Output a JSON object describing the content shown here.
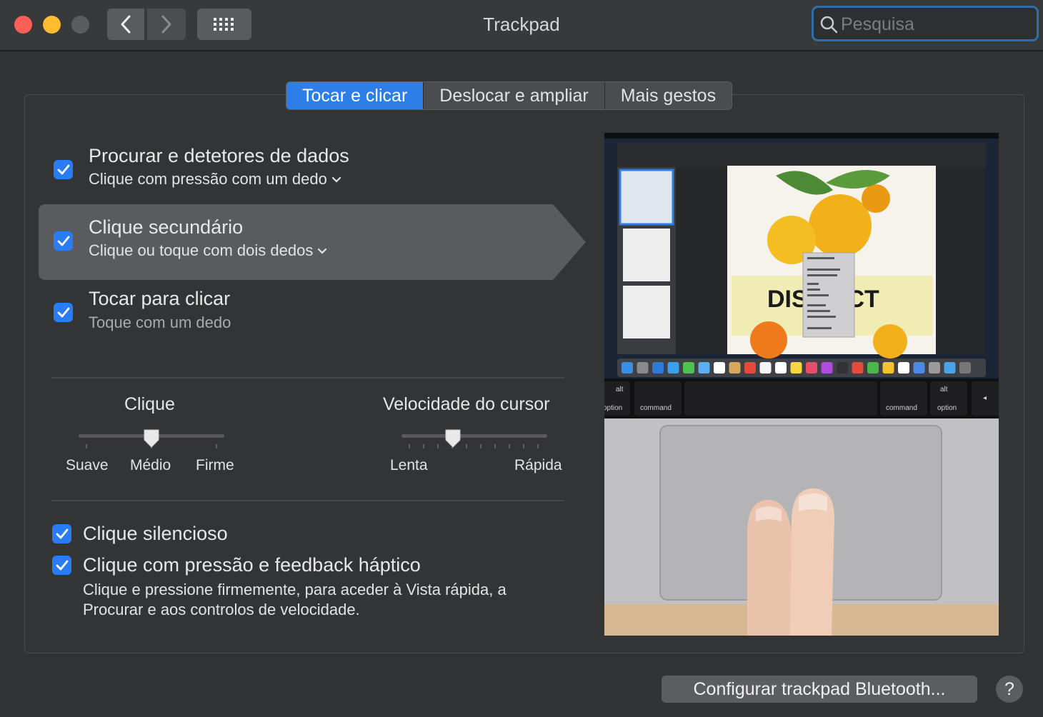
{
  "window": {
    "title": "Trackpad",
    "search_placeholder": "Pesquisa"
  },
  "tabs": [
    {
      "label": "Tocar e clicar",
      "active": true
    },
    {
      "label": "Deslocar e ampliar",
      "active": false
    },
    {
      "label": "Mais gestos",
      "active": false
    }
  ],
  "options": [
    {
      "title": "Procurar e detetores de dados",
      "subtitle": "Clique com pressão com um dedo",
      "checked": true,
      "has_dropdown": true
    },
    {
      "title": "Clique secundário",
      "subtitle": "Clique ou toque com dois dedos",
      "checked": true,
      "has_dropdown": true,
      "selected": true
    },
    {
      "title": "Tocar para clicar",
      "subtitle": "Toque com um dedo",
      "checked": true,
      "has_dropdown": false
    }
  ],
  "sliders": {
    "click": {
      "title": "Clique",
      "labels": [
        "Suave",
        "Médio",
        "Firme"
      ],
      "value_index": 1,
      "steps": 3
    },
    "tracking": {
      "title": "Velocidade do cursor",
      "min_label": "Lenta",
      "max_label": "Rápida",
      "value_fraction": 0.35,
      "steps": 10
    }
  },
  "bottom_options": [
    {
      "title": "Clique silencioso",
      "checked": true
    },
    {
      "title": "Clique com pressão e feedback háptico",
      "checked": true
    }
  ],
  "force_click_note": "Clique e pressione firmemente, para aceder à Vista rápida, a Procurar e aos controlos de velocidade.",
  "preview": {
    "keys": [
      "alt",
      "option",
      "command",
      "command",
      "alt",
      "option"
    ],
    "doc_text": "DISTRICT"
  },
  "buttons": {
    "bluetooth": "Configurar trackpad Bluetooth...",
    "help": "?"
  },
  "colors": {
    "accent": "#2a7cf5",
    "window_bg": "#323335",
    "selection": "#5a5b5f"
  }
}
